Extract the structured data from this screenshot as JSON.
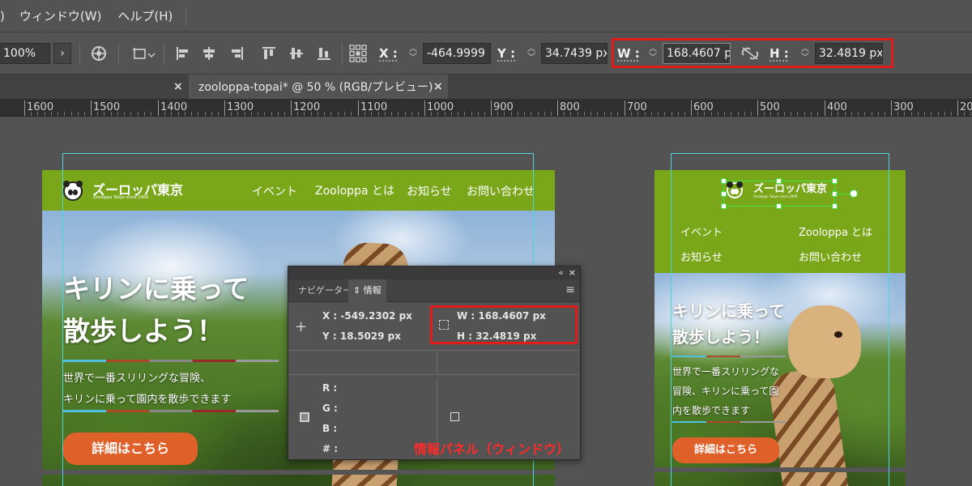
{
  "menubar": {
    "items": [
      ")",
      "ウィンドウ(W)",
      "ヘルプ(H)"
    ]
  },
  "controlbar": {
    "zoom": "100%",
    "zoom_arrow": "›",
    "x_label": "X :",
    "x_value": "-464.9999",
    "y_label": "Y :",
    "y_value": "34.7439 px",
    "w_label": "W :",
    "w_value": "168.4607 p",
    "h_label": "H :",
    "h_value": "32.4819 px",
    "highlight_color": "#e21a1a"
  },
  "tabs": {
    "active_title": "zooloppa-topai* @ 50 % (RGB/プレビュー)",
    "close_glyph": "×"
  },
  "ruler": {
    "labels": [
      "1600",
      "1500",
      "1400",
      "1300",
      "1200",
      "1100",
      "1000",
      "900",
      "800",
      "700",
      "600",
      "500",
      "400",
      "300",
      "20"
    ]
  },
  "site": {
    "title": "ズーロッパ東京",
    "subtitle": "Zooloppa Tokyo since 1969",
    "nav": [
      "イベント",
      "Zooloppa とは",
      "お知らせ",
      "お問い合わせ"
    ],
    "hero_line1": "キリンに乗って",
    "hero_line2": "散歩しよう！",
    "body_line1": "世界で一番スリリングな冒険、",
    "body_line2": "キリンに乗って園内を散歩できます",
    "cta": "詳細はこちら",
    "mobile_body_line1": "世界で一番スリリングな",
    "mobile_body_line2": "冒険、キリンに乗って園",
    "mobile_body_line3": "内を散歩できます",
    "header_color": "#7aa71a",
    "cta_color": "#e0602a"
  },
  "panel": {
    "close": "×",
    "collapse": "«",
    "tab_navigator": "ナビゲーター",
    "tab_info": "情報",
    "tab_info_arrow": "⇕",
    "menu_icon": "≡",
    "x_line": "X :  -549.2302 px",
    "y_line": "Y :  18.5029 px",
    "w_line": "W :  168.4607 px",
    "h_line": "H :  32.4819 px",
    "r": "R :",
    "g": "G :",
    "b": "B :",
    "hash": "# :",
    "annotation": "情報パネル（ウィンドウ）",
    "annotation_color": "#ff2a2a"
  }
}
